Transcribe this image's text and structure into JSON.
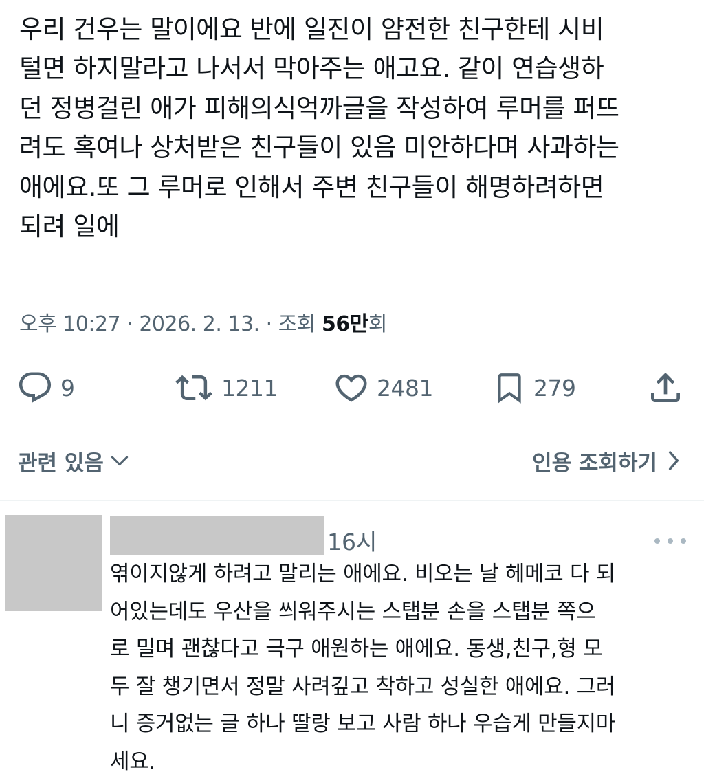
{
  "tweet": {
    "text": "우리 건우는 말이에요 반에 일진이 얌전한 친구한테 시비\n털면 하지말라고 나서서 막아주는 애고요. 같이 연습생하\n던 정병걸린 애가 피해의식억까글을 작성하여 루머를 퍼뜨\n려도 혹여나 상처받은 친구들이 있음 미안하다며 사과하는\n애에요.또 그 루머로 인해서 주변 친구들이 해명하려하면\n되려 일에",
    "time": "오후 10:27",
    "date": "2026. 2. 13.",
    "views_label": "조회",
    "views_count": "56만",
    "views_unit": "회"
  },
  "actions": {
    "replies": "9",
    "retweets": "1211",
    "likes": "2481",
    "bookmarks": "279"
  },
  "related_label": "관련 있음",
  "quotes_label": "인용 조회하기",
  "reply": {
    "time": "16시",
    "text": "엮이지않게 하려고 말리는 애에요. 비오는 날 헤메코 다 되\n어있는데도 우산을 씌워주시는 스탭분 손을 스탭분 쪽으\n로 밀며 괜찮다고 극구 애원하는 애에요. 동생,친구,형 모\n두 잘 챙기면서 정말 사려깊고 착하고 성실한 애에요. 그러\n니 증거없는 글 하나 딸랑 보고 사람 하나 우습게 만들지마\n세요."
  },
  "colors": {
    "text": "#0f1419",
    "secondary": "#536471",
    "redaction": "#c8c8c8",
    "divider": "#eff3f4"
  }
}
